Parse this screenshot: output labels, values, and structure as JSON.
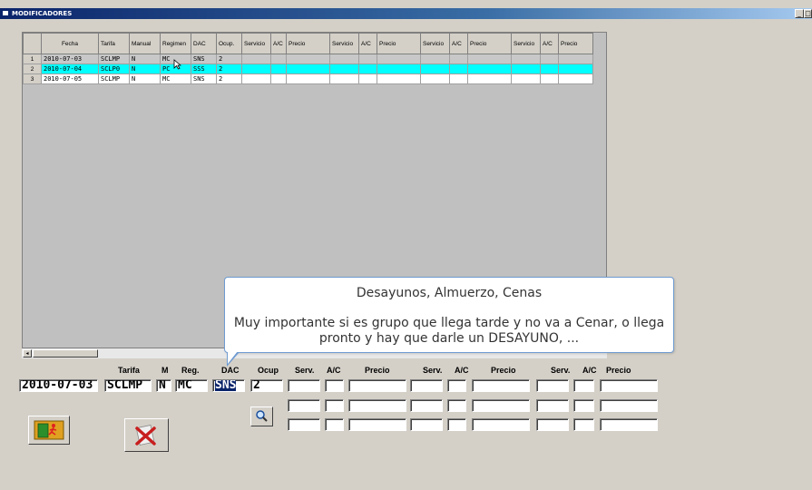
{
  "window": {
    "title": "MODIFICADORES",
    "controls": [
      "_",
      "□"
    ]
  },
  "grid": {
    "headers": [
      "Fecha",
      "Tarifa",
      "Manual",
      "Regimen",
      "DAC",
      "Ocup.",
      "Servicio",
      "A/C",
      "Precio",
      "Servicio",
      "A/C",
      "Precio",
      "Servicio",
      "A/C",
      "Precio",
      "Servicio",
      "A/C",
      "Precio"
    ],
    "rows": [
      {
        "n": "1",
        "fecha": "2010-07-03",
        "tarifa": "SCLMP",
        "manual": "N",
        "regimen": "MC",
        "dac": "SNS",
        "ocup": "2"
      },
      {
        "n": "2",
        "fecha": "2010-07-04",
        "tarifa": "SCLP0",
        "manual": "N",
        "regimen": "PC",
        "dac": "SSS",
        "ocup": "2"
      },
      {
        "n": "3",
        "fecha": "2010-07-05",
        "tarifa": "SCLMP",
        "manual": "N",
        "regimen": "MC",
        "dac": "SNS",
        "ocup": "2"
      }
    ]
  },
  "tooltip": {
    "title": "Desayunos, Almuerzo, Cenas",
    "body": "Muy importante si es grupo que llega tarde y no va a Cenar, o llega pronto y hay que darle un DESAYUNO, ..."
  },
  "form": {
    "labels": {
      "tarifa": "Tarifa",
      "m": "M",
      "reg": "Reg.",
      "dac": "DAC",
      "ocup": "Ocup",
      "serv1": "Serv.",
      "ac1": "A/C",
      "precio1": "Precio",
      "serv2": "Serv.",
      "ac2": "A/C",
      "precio2": "Precio",
      "serv3": "Serv.",
      "ac3": "A/C",
      "precio3": "Precio"
    },
    "values": {
      "fecha": "2010-07-03",
      "tarifa": "SCLMP",
      "m": "N",
      "reg": "MC",
      "dac": "SNS",
      "ocup": "2"
    }
  },
  "icons": {
    "search": "search-icon",
    "exit": "exit-icon",
    "delete": "delete-icon"
  }
}
